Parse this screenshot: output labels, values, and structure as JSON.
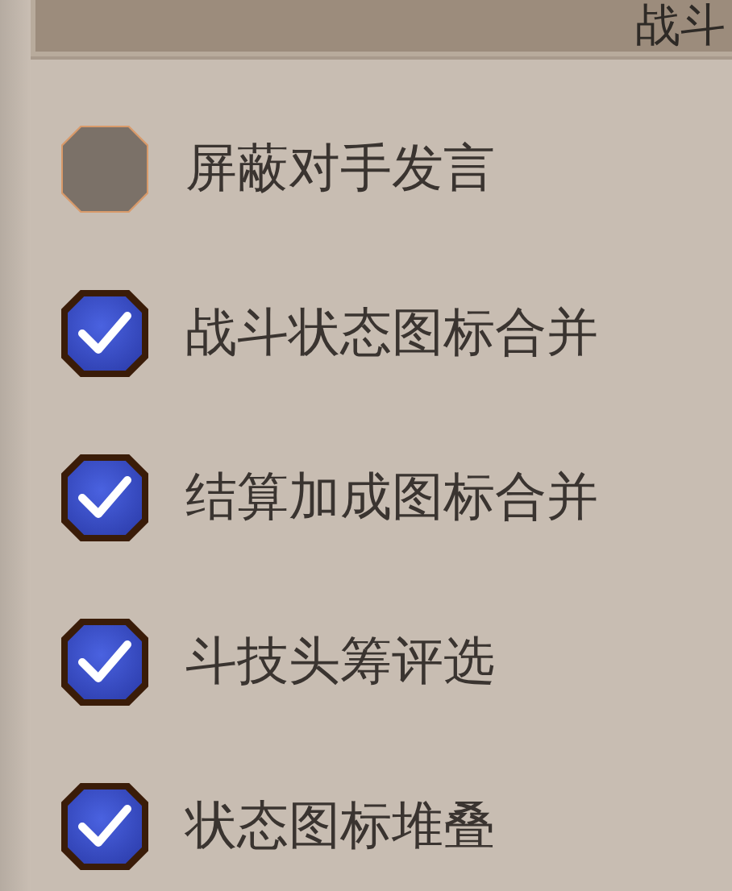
{
  "header": {
    "title": "战斗"
  },
  "options": [
    {
      "label": "屏蔽对手发言",
      "checked": false
    },
    {
      "label": "战斗状态图标合并",
      "checked": true
    },
    {
      "label": "结算加成图标合并",
      "checked": true
    },
    {
      "label": "斗技头筹评选",
      "checked": true
    },
    {
      "label": "状态图标堆叠",
      "checked": true
    }
  ]
}
